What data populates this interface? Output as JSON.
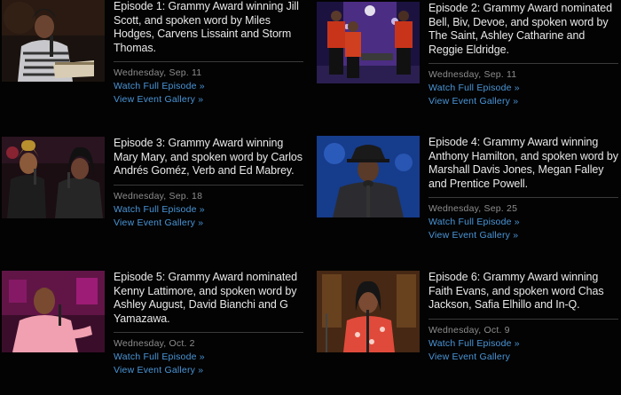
{
  "episodes": [
    {
      "title": "Episode 1: Grammy Award winning Jill Scott, and spoken word by Miles Hodges, Carvens Lissaint and Storm Thomas.",
      "date": "Wednesday, Sep. 11",
      "watch_label": "Watch Full Episode »",
      "gallery_label": "View Event Gallery »"
    },
    {
      "title": "Episode 2: Grammy Award nominated Bell, Biv, Devoe, and spoken word by The Saint, Ashley Catharine and Reggie Eldridge.",
      "date": "Wednesday, Sep. 11",
      "watch_label": "Watch Full Episode »",
      "gallery_label": "View Event Gallery »"
    },
    {
      "title": "Episode 3: Grammy Award winning Mary Mary, and spoken word by Carlos Andrés Goméz, Verb and Ed Mabrey.",
      "date": "Wednesday, Sep. 18",
      "watch_label": "Watch Full Episode »",
      "gallery_label": "View Event Gallery »"
    },
    {
      "title": "Episode 4: Grammy Award winning Anthony Hamilton, and spoken word by Marshall Davis Jones, Megan Falley and Prentice Powell.",
      "date": "Wednesday, Sep. 25",
      "watch_label": "Watch Full Episode »",
      "gallery_label": "View Event Gallery »"
    },
    {
      "title": "Episode 5: Grammy Award nominated Kenny Lattimore, and spoken word by Ashley August, David Bianchi and G Yamazawa.",
      "date": "Wednesday, Oct. 2",
      "watch_label": "Watch Full Episode »",
      "gallery_label": "View Event Gallery »"
    },
    {
      "title": "Episode 6: Grammy Award winning Faith Evans, and spoken word Chas Jackson, Safia Elhillo and In-Q.",
      "date": "Wednesday, Oct. 9",
      "watch_label": "Watch Full Episode »",
      "gallery_label": "View Event Gallery"
    }
  ],
  "colors": {
    "background": "#030303",
    "title": "#e8e8e8",
    "date": "#8d8d8d",
    "link": "#4a96d8"
  }
}
